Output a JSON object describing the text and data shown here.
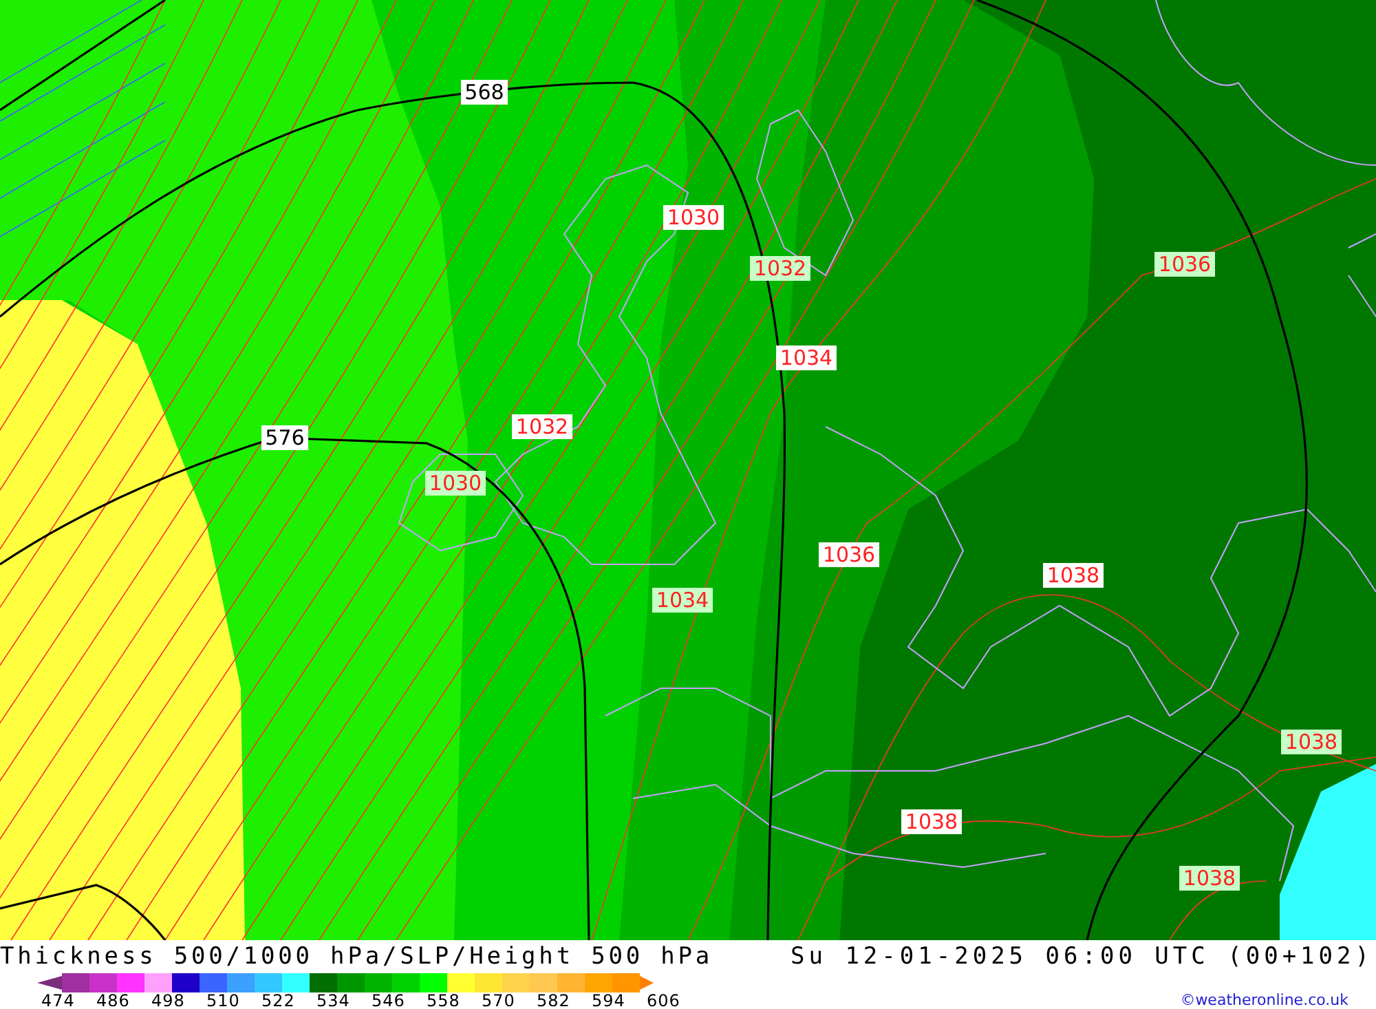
{
  "map": {
    "thickness_labels": [
      "568",
      "576"
    ],
    "isobar_labels": [
      "1030",
      "1032",
      "1034",
      "1036",
      "1032",
      "1030",
      "1036",
      "1034",
      "1038",
      "1038",
      "1038",
      "1038"
    ]
  },
  "title": "Thickness 500/1000 hPa/SLP/Height 500 hPa",
  "valid_time": "Su 12-01-2025 06:00 UTC (00+102)",
  "legend": {
    "swatches": [
      {
        "color": "#a030a0"
      },
      {
        "color": "#c832c8"
      },
      {
        "color": "#ff32ff"
      },
      {
        "color": "#ffa0ff"
      },
      {
        "color": "#1e00c8"
      },
      {
        "color": "#3c64ff"
      },
      {
        "color": "#3ca0ff"
      },
      {
        "color": "#32c8ff"
      },
      {
        "color": "#32ffff"
      },
      {
        "color": "#006e00"
      },
      {
        "color": "#009600"
      },
      {
        "color": "#00b400"
      },
      {
        "color": "#00d200"
      },
      {
        "color": "#00ff00"
      },
      {
        "color": "#ffff32"
      },
      {
        "color": "#ffe632"
      },
      {
        "color": "#ffd24b"
      },
      {
        "color": "#ffc850"
      },
      {
        "color": "#ffb432"
      },
      {
        "color": "#ffa500"
      },
      {
        "color": "#ff9600"
      }
    ],
    "labels": [
      "474",
      "486",
      "498",
      "510",
      "522",
      "534",
      "546",
      "558",
      "570",
      "582",
      "594",
      "606"
    ]
  },
  "credit": "©weatheronline.co.uk"
}
